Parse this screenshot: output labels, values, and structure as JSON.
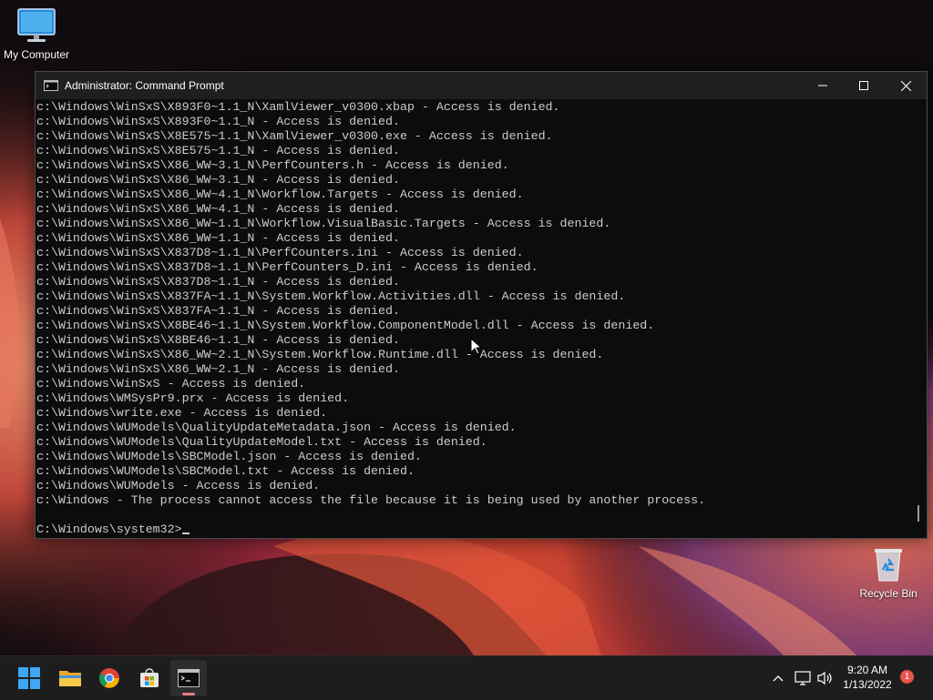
{
  "desktop": {
    "icons": [
      {
        "label": "My Computer",
        "icon": "monitor-icon"
      },
      {
        "label": "Recycle Bin",
        "icon": "recycle-bin-icon"
      }
    ]
  },
  "window": {
    "title": "Administrator: Command Prompt",
    "icon": "cmd-icon",
    "controls": [
      "minimize-icon",
      "maximize-icon",
      "close-icon"
    ]
  },
  "console": {
    "lines": [
      "c:\\Windows\\WinSxS\\X893F0~1.1_N\\XamlViewer_v0300.xbap - Access is denied.",
      "c:\\Windows\\WinSxS\\X893F0~1.1_N - Access is denied.",
      "c:\\Windows\\WinSxS\\X8E575~1.1_N\\XamlViewer_v0300.exe - Access is denied.",
      "c:\\Windows\\WinSxS\\X8E575~1.1_N - Access is denied.",
      "c:\\Windows\\WinSxS\\X86_WW~3.1_N\\PerfCounters.h - Access is denied.",
      "c:\\Windows\\WinSxS\\X86_WW~3.1_N - Access is denied.",
      "c:\\Windows\\WinSxS\\X86_WW~4.1_N\\Workflow.Targets - Access is denied.",
      "c:\\Windows\\WinSxS\\X86_WW~4.1_N - Access is denied.",
      "c:\\Windows\\WinSxS\\X86_WW~1.1_N\\Workflow.VisualBasic.Targets - Access is denied.",
      "c:\\Windows\\WinSxS\\X86_WW~1.1_N - Access is denied.",
      "c:\\Windows\\WinSxS\\X837D8~1.1_N\\PerfCounters.ini - Access is denied.",
      "c:\\Windows\\WinSxS\\X837D8~1.1_N\\PerfCounters_D.ini - Access is denied.",
      "c:\\Windows\\WinSxS\\X837D8~1.1_N - Access is denied.",
      "c:\\Windows\\WinSxS\\X837FA~1.1_N\\System.Workflow.Activities.dll - Access is denied.",
      "c:\\Windows\\WinSxS\\X837FA~1.1_N - Access is denied.",
      "c:\\Windows\\WinSxS\\X8BE46~1.1_N\\System.Workflow.ComponentModel.dll - Access is denied.",
      "c:\\Windows\\WinSxS\\X8BE46~1.1_N - Access is denied.",
      "c:\\Windows\\WinSxS\\X86_WW~2.1_N\\System.Workflow.Runtime.dll - Access is denied.",
      "c:\\Windows\\WinSxS\\X86_WW~2.1_N - Access is denied.",
      "c:\\Windows\\WinSxS - Access is denied.",
      "c:\\Windows\\WMSysPr9.prx - Access is denied.",
      "c:\\Windows\\write.exe - Access is denied.",
      "c:\\Windows\\WUModels\\QualityUpdateMetadata.json - Access is denied.",
      "c:\\Windows\\WUModels\\QualityUpdateModel.txt - Access is denied.",
      "c:\\Windows\\WUModels\\SBCModel.json - Access is denied.",
      "c:\\Windows\\WUModels\\SBCModel.txt - Access is denied.",
      "c:\\Windows\\WUModels - Access is denied.",
      "c:\\Windows - The process cannot access the file because it is being used by another process."
    ],
    "prompt": "C:\\Windows\\system32>"
  },
  "taskbar": {
    "apps": [
      {
        "name": "start",
        "icon": "windows-start-icon",
        "active": false
      },
      {
        "name": "file-explorer",
        "icon": "folder-icon",
        "active": false
      },
      {
        "name": "chrome",
        "icon": "chrome-icon",
        "active": false
      },
      {
        "name": "store",
        "icon": "store-icon",
        "active": false
      },
      {
        "name": "command-prompt",
        "icon": "cmd-icon",
        "active": true
      }
    ],
    "tray": {
      "icons": [
        "chevron-up-icon",
        "network-icon",
        "volume-icon"
      ],
      "time": "9:20 AM",
      "date": "1/13/2022",
      "notification_count": "1"
    }
  },
  "colors": {
    "console_bg": "#0c0c0c",
    "console_text": "#cccccc",
    "titlebar": "#1f1f1f",
    "taskbar": "#1d1d1d",
    "notification_badge": "#e8534a"
  }
}
